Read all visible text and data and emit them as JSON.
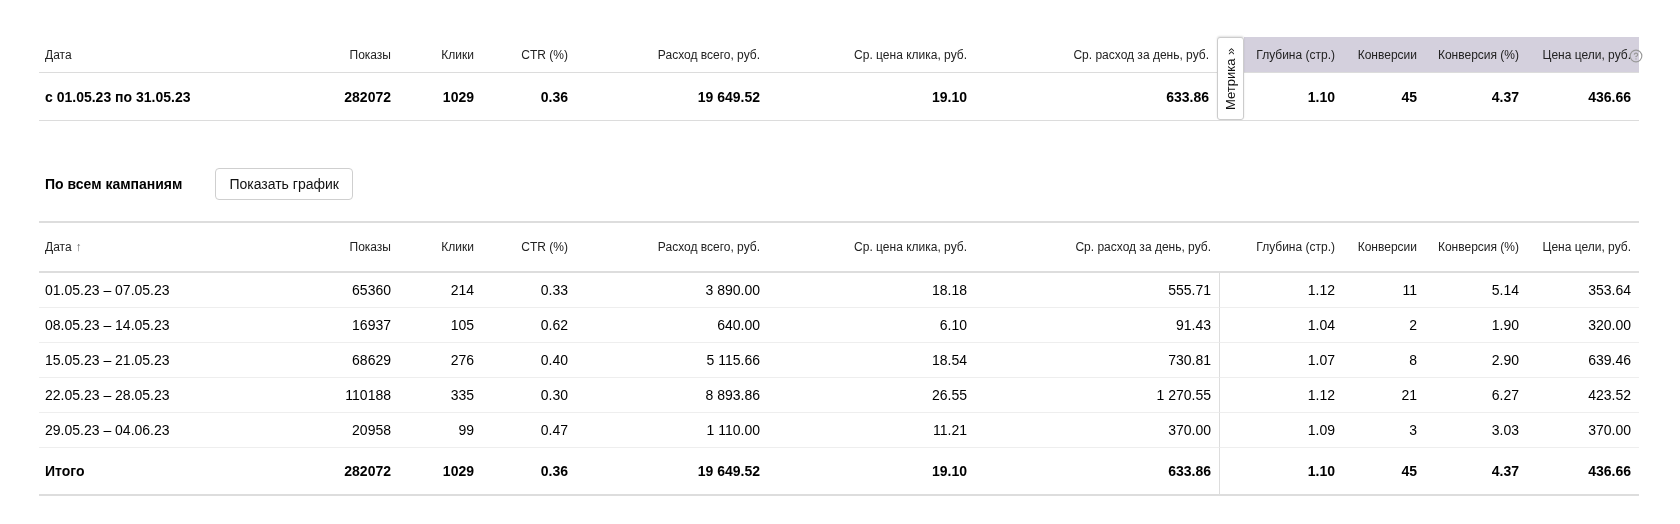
{
  "summary": {
    "columns": [
      {
        "label": "Дата",
        "highlighted": false
      },
      {
        "label": "Показы",
        "highlighted": false
      },
      {
        "label": "Клики",
        "highlighted": false
      },
      {
        "label": "CTR (%)",
        "highlighted": false
      },
      {
        "label": "Расход всего, руб.",
        "highlighted": false
      },
      {
        "label": "Ср. цена клика, руб.",
        "highlighted": false
      },
      {
        "label": "Ср. расход за день, руб.",
        "highlighted": false
      },
      {
        "label": "Глубина (стр.)",
        "highlighted": true
      },
      {
        "label": "Конверсии",
        "highlighted": true
      },
      {
        "label": "Конверсия (%)",
        "highlighted": true
      },
      {
        "label": "Цена цели, руб.",
        "highlighted": true
      }
    ],
    "metrika_tab": "Метрика »",
    "row": [
      "с 01.05.23 по 31.05.23",
      "282072",
      "1029",
      "0.36",
      "19 649.52",
      "19.10",
      "633.86",
      "1.10",
      "45",
      "4.37",
      "436.66"
    ]
  },
  "section": {
    "title": "По всем кампаниям",
    "button": "Показать график"
  },
  "table": {
    "columns": [
      {
        "label": "Дата",
        "divided": false
      },
      {
        "label": "Показы",
        "divided": false
      },
      {
        "label": "Клики",
        "divided": false
      },
      {
        "label": "CTR (%)",
        "divided": false
      },
      {
        "label": "Расход всего, руб.",
        "divided": false
      },
      {
        "label": "Ср. цена клика, руб.",
        "divided": false
      },
      {
        "label": "Ср. расход за день, руб.",
        "divided": false
      },
      {
        "label": "Глубина (стр.)",
        "divided": true
      },
      {
        "label": "Конверсии",
        "divided": false
      },
      {
        "label": "Конверсия (%)",
        "divided": false
      },
      {
        "label": "Цена цели, руб.",
        "divided": false
      }
    ],
    "sort_icon": "↑",
    "rows": [
      [
        "01.05.23 – 07.05.23",
        "65360",
        "214",
        "0.33",
        "3 890.00",
        "18.18",
        "555.71",
        "1.12",
        "11",
        "5.14",
        "353.64"
      ],
      [
        "08.05.23 – 14.05.23",
        "16937",
        "105",
        "0.62",
        "640.00",
        "6.10",
        "91.43",
        "1.04",
        "2",
        "1.90",
        "320.00"
      ],
      [
        "15.05.23 – 21.05.23",
        "68629",
        "276",
        "0.40",
        "5 115.66",
        "18.54",
        "730.81",
        "1.07",
        "8",
        "2.90",
        "639.46"
      ],
      [
        "22.05.23 – 28.05.23",
        "110188",
        "335",
        "0.30",
        "8 893.86",
        "26.55",
        "1 270.55",
        "1.12",
        "21",
        "6.27",
        "423.52"
      ],
      [
        "29.05.23 – 04.06.23",
        "20958",
        "99",
        "0.47",
        "1 110.00",
        "11.21",
        "370.00",
        "1.09",
        "3",
        "3.03",
        "370.00"
      ]
    ],
    "total": [
      "Итого",
      "282072",
      "1029",
      "0.36",
      "19 649.52",
      "19.10",
      "633.86",
      "1.10",
      "45",
      "4.37",
      "436.66"
    ]
  }
}
